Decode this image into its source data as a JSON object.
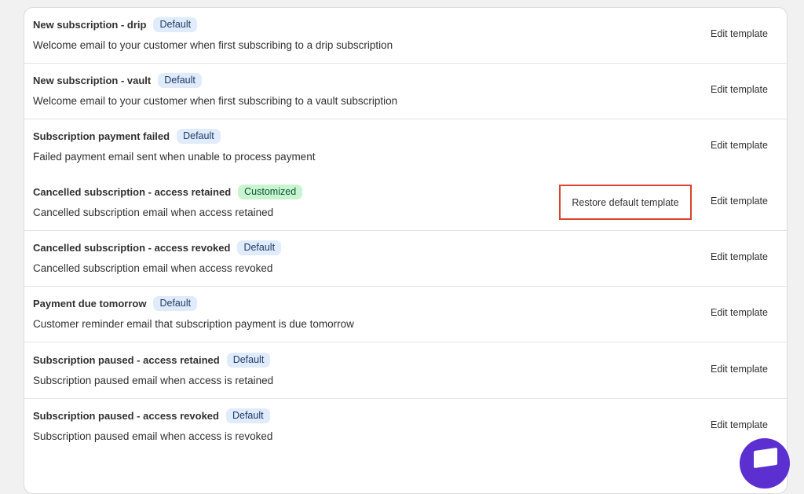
{
  "templates": [
    {
      "title": "New subscription - drip",
      "badge": "Default",
      "badge_type": "default",
      "description": "Welcome email to your customer when first subscribing to a drip subscription",
      "edit_label": "Edit template"
    },
    {
      "title": "New subscription - vault",
      "badge": "Default",
      "badge_type": "default",
      "description": "Welcome email to your customer when first subscribing to a vault subscription",
      "edit_label": "Edit template"
    },
    {
      "title": "Subscription payment failed",
      "badge": "Default",
      "badge_type": "default",
      "description": "Failed payment email sent when unable to process payment",
      "edit_label": "Edit template"
    },
    {
      "title": "Cancelled subscription - access retained",
      "badge": "Customized",
      "badge_type": "custom",
      "description": "Cancelled subscription email when access retained",
      "edit_label": "Edit template",
      "restore_label": "Restore default template"
    },
    {
      "title": "Cancelled subscription - access revoked",
      "badge": "Default",
      "badge_type": "default",
      "description": "Cancelled subscription email when access revoked",
      "edit_label": "Edit template"
    },
    {
      "title": "Payment due tomorrow",
      "badge": "Default",
      "badge_type": "default",
      "description": "Customer reminder email that subscription payment is due tomorrow",
      "edit_label": "Edit template"
    },
    {
      "title": "Subscription paused - access retained",
      "badge": "Default",
      "badge_type": "default",
      "description": "Subscription paused email when access is retained",
      "edit_label": "Edit template"
    },
    {
      "title": "Subscription paused - access revoked",
      "badge": "Default",
      "badge_type": "default",
      "description": "Subscription paused email when access is revoked",
      "edit_label": "Edit template"
    }
  ],
  "colors": {
    "badge_default_bg": "#e0ebfb",
    "badge_custom_bg": "#c8f5cf",
    "highlight_border": "#d9422b",
    "chat_button": "#5b2fd0"
  },
  "chat_widget": {
    "icon": "chat-icon"
  }
}
